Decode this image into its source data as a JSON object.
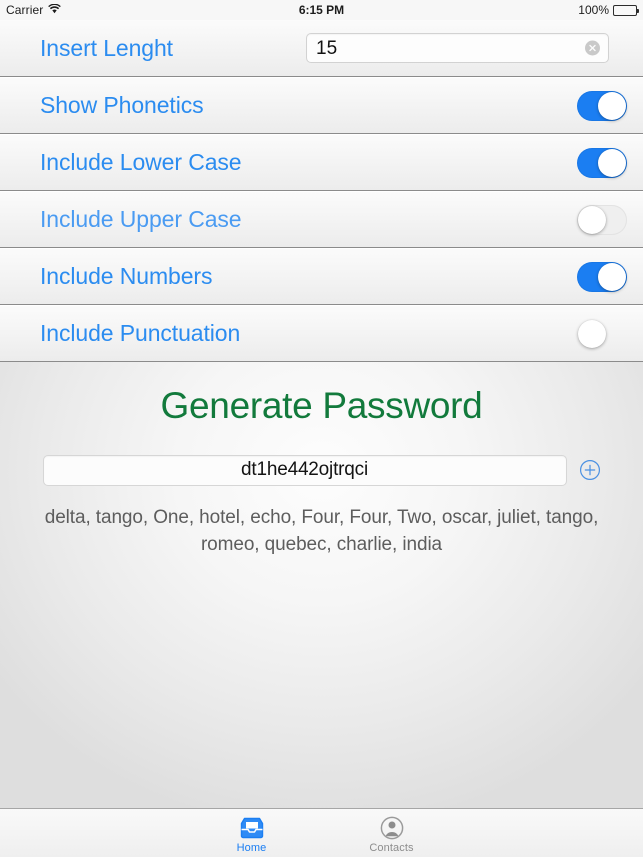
{
  "status_bar": {
    "carrier": "Carrier",
    "wifi_icon": "wifi-icon",
    "time": "6:15 PM",
    "battery_percent": "100%",
    "battery_icon": "battery-full-icon"
  },
  "settings": {
    "rows": [
      {
        "label": "Insert Lenght",
        "type": "text-field",
        "value": "15",
        "placeholder": "",
        "clear_icon": "clear-circle-icon"
      },
      {
        "label": "Show Phonetics",
        "type": "switch",
        "state": "on"
      },
      {
        "label": "Include Lower Case",
        "type": "switch",
        "state": "on"
      },
      {
        "label": "Include Upper Case",
        "type": "switch",
        "state": "off"
      },
      {
        "label": "Include Numbers",
        "type": "switch",
        "state": "on"
      },
      {
        "label": "Include Punctuation",
        "type": "switch",
        "state": "off"
      }
    ]
  },
  "main": {
    "generate_title": "Generate Password",
    "password": "dt1he442ojtrqci",
    "add_icon": "plus-circle-icon",
    "phonetics": "delta, tango, One, hotel, echo, Four, Four, Two, oscar, juliet, tango, romeo, quebec, charlie, india"
  },
  "tabbar": {
    "tabs": [
      {
        "label": "Home",
        "icon": "inbox-tray-icon",
        "active": true
      },
      {
        "label": "Contacts",
        "icon": "person-circle-icon",
        "active": false
      }
    ]
  },
  "colors": {
    "accent_blue": "#1b7ef2",
    "label_blue": "#2b8cf0",
    "green": "#127a3c",
    "inactive_gray": "#8d8d8d"
  }
}
